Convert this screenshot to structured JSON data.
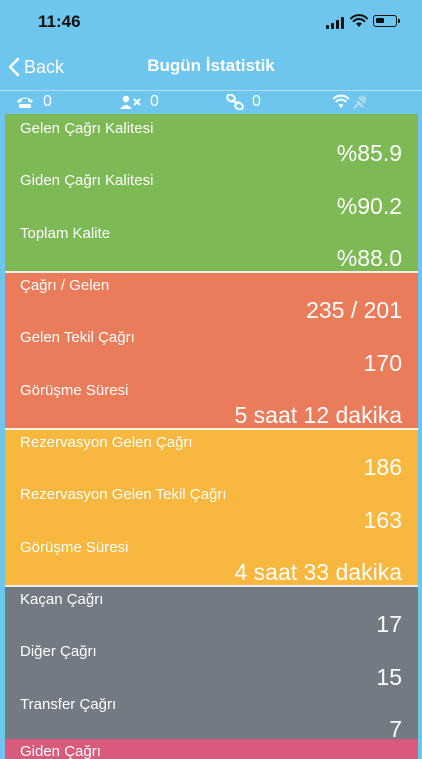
{
  "status_bar": {
    "time": "11:46"
  },
  "nav": {
    "back_label": "Back",
    "title": "Bugün İstatistik"
  },
  "indicators": [
    {
      "icon": "phone-icon",
      "value": "0"
    },
    {
      "icon": "user-x-icon",
      "value": "0"
    },
    {
      "icon": "link-icon",
      "value": "0"
    },
    {
      "icon": "wifi-plug-icon",
      "value": ""
    }
  ],
  "sections": [
    {
      "color": "#7DB954",
      "rows": [
        {
          "label": "Gelen Çağrı Kalitesi",
          "value": "%85.9"
        },
        {
          "label": "Giden Çağrı Kalitesi",
          "value": "%90.2"
        },
        {
          "label": "Toplam Kalite",
          "value": "%88.0"
        }
      ]
    },
    {
      "color": "#EB7C5B",
      "rows": [
        {
          "label": "Çağrı / Gelen",
          "value": "235 / 201"
        },
        {
          "label": "Gelen Tekil Çağrı",
          "value": "170"
        },
        {
          "label": "Görüşme Süresi",
          "value": "5 saat 12 dakika"
        }
      ]
    },
    {
      "color": "#F8B73E",
      "rows": [
        {
          "label": "Rezervasyon Gelen Çağrı",
          "value": "186"
        },
        {
          "label": "Rezervasyon Gelen Tekil Çağrı",
          "value": "163"
        },
        {
          "label": "Görüşme Süresi",
          "value": "4 saat 33 dakika"
        }
      ]
    },
    {
      "color": "#737A84",
      "rows": [
        {
          "label": "Kaçan Çağrı",
          "value": "17"
        },
        {
          "label": "Diğer Çağrı",
          "value": "15"
        },
        {
          "label": "Transfer Çağrı",
          "value": "7"
        }
      ]
    }
  ],
  "peek_section": {
    "color": "#D95A7A",
    "label": "Giden Çağrı"
  }
}
